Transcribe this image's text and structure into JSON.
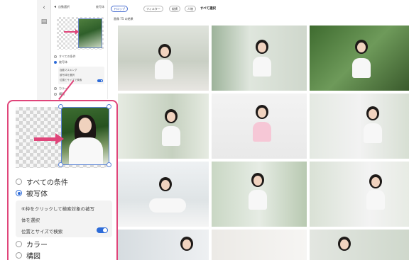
{
  "side_panel": {
    "title": "自動選択",
    "right": "被写体",
    "options": [
      "すべての条件",
      "被写体"
    ],
    "box_lines": [
      "自動マスキング",
      "被写体を選択",
      "位置とサイズで検索"
    ],
    "options_after": [
      "カラー",
      "構図"
    ]
  },
  "top_bar": {
    "filters": [
      "ドロップ",
      "フィルター",
      "縦横",
      "人物"
    ],
    "select_all": "すべて選択",
    "info": "画像 75 の結果"
  },
  "callout": {
    "options": [
      {
        "label": "すべての条件",
        "selected": false
      },
      {
        "label": "被写体",
        "selected": true
      }
    ],
    "box_lines": [
      "⑥枠をクリックして検索対象の被写",
      "体を選択",
      "位置とサイズで検索"
    ],
    "toggle_on": true,
    "options_after": [
      "カラー",
      "構図"
    ]
  },
  "colors": {
    "accent_pink": "#e0457a",
    "toggle_blue": "#2d6bd8"
  }
}
